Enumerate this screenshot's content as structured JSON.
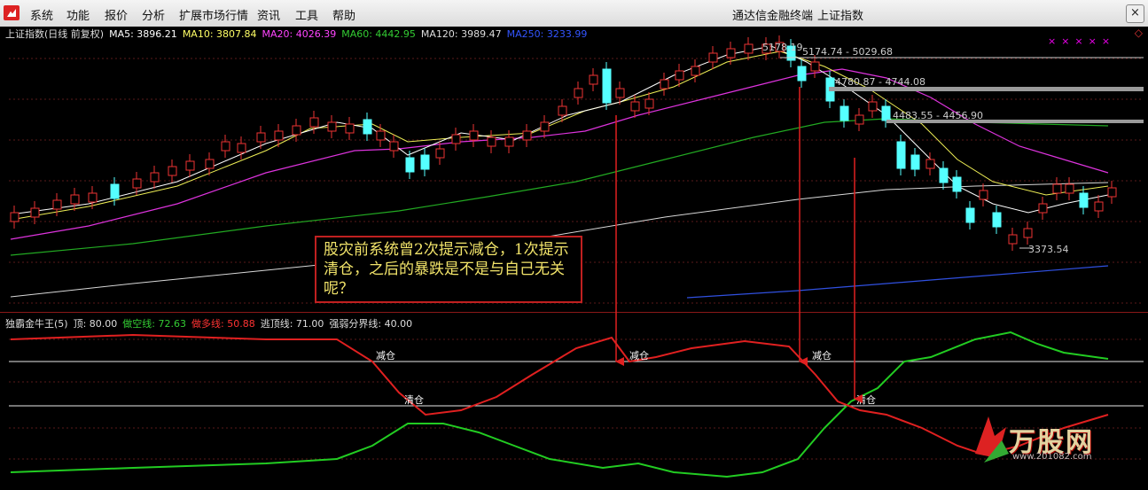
{
  "menu": {
    "items": [
      "系统",
      "功能",
      "报价",
      "分析",
      "扩展市场行情",
      "资讯",
      "工具",
      "帮助"
    ],
    "app_name": "通达信金融终端",
    "window_title": "上证指数",
    "close_glyph": "×"
  },
  "main_legend": {
    "title": "上证指数(日线 前复权)",
    "ma5": "MA5: 3896.21",
    "ma10": "MA10: 3807.84",
    "ma20": "MA20: 4026.39",
    "ma60": "MA60: 4442.95",
    "ma120": "MA120: 3989.47",
    "ma250": "MA250: 3233.99",
    "colors": {
      "ma5": "#ffffff",
      "ma10": "#ffff66",
      "ma20": "#ff44ff",
      "ma60": "#33cc33",
      "ma120": "#dddddd",
      "ma250": "#3355ff"
    }
  },
  "price_labels": {
    "high": "5178.19",
    "gap1": "5174.74 - 5029.68",
    "gap2": "4780.87 - 4744.08",
    "gap3": "4483.55 - 4456.90",
    "low": "3373.54"
  },
  "annotation": {
    "text": "股灾前系统曾2次提示减仓，1次提示清仓，之后的暴跌是不是与自己无关呢？"
  },
  "indicator_legend": {
    "name": "独霸金牛王(5)",
    "top": "顶: 80.00",
    "short_line": "做空线: 72.63",
    "long_line": "做多线: 50.88",
    "escape_line": "逃顶线: 71.00",
    "strength_line": "强弱分界线: 40.00",
    "colors": {
      "short": "#33cc33",
      "long": "#ff3333"
    }
  },
  "signals": {
    "reduce": "减仓",
    "clear": "清仓"
  },
  "watermark": {
    "brand": "万股网",
    "url": "www.201082.com"
  }
}
